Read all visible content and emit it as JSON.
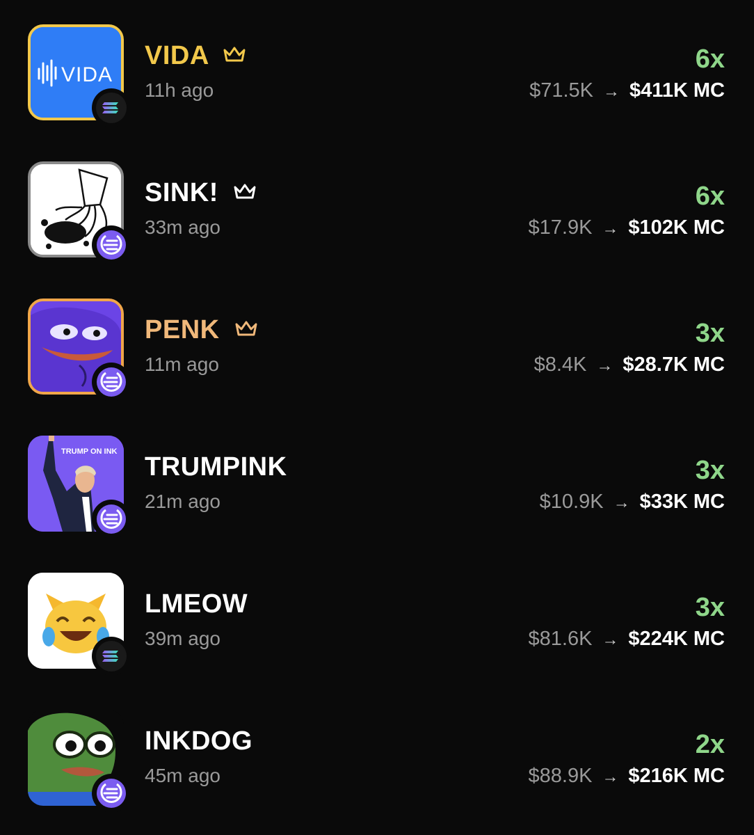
{
  "tokens": [
    {
      "name": "VIDA",
      "crown": true,
      "name_color": "#f2c84b",
      "age": "11h ago",
      "multiplier": "6x",
      "from": "$71.5K",
      "arrow": "→",
      "to": "$411K",
      "unit": "MC",
      "chain": "solana-icon",
      "logo_text": "VIDA"
    },
    {
      "name": "SINK!",
      "crown": true,
      "name_color": "#ffffff",
      "age": "33m ago",
      "multiplier": "6x",
      "from": "$17.9K",
      "arrow": "→",
      "to": "$102K",
      "unit": "MC",
      "chain": "ink-icon"
    },
    {
      "name": "PENK",
      "crown": true,
      "name_color": "#f0b87a",
      "age": "11m ago",
      "multiplier": "3x",
      "from": "$8.4K",
      "arrow": "→",
      "to": "$28.7K",
      "unit": "MC",
      "chain": "ink-icon"
    },
    {
      "name": "TRUMPINK",
      "crown": false,
      "name_color": "#ffffff",
      "age": "21m ago",
      "multiplier": "3x",
      "from": "$10.9K",
      "arrow": "→",
      "to": "$33K",
      "unit": "MC",
      "chain": "ink-icon",
      "logo_text": "TRUMP ON INK"
    },
    {
      "name": "LMEOW",
      "crown": false,
      "name_color": "#ffffff",
      "age": "39m ago",
      "multiplier": "3x",
      "from": "$81.6K",
      "arrow": "→",
      "to": "$224K",
      "unit": "MC",
      "chain": "solana-icon"
    },
    {
      "name": "INKDOG",
      "crown": false,
      "name_color": "#ffffff",
      "age": "45m ago",
      "multiplier": "2x",
      "from": "$88.9K",
      "arrow": "→",
      "to": "$216K",
      "unit": "MC",
      "chain": "ink-icon"
    }
  ],
  "colors": {
    "multiplier": "#8fd68a",
    "background": "#0a0a0a",
    "muted": "#9a9a9a"
  }
}
